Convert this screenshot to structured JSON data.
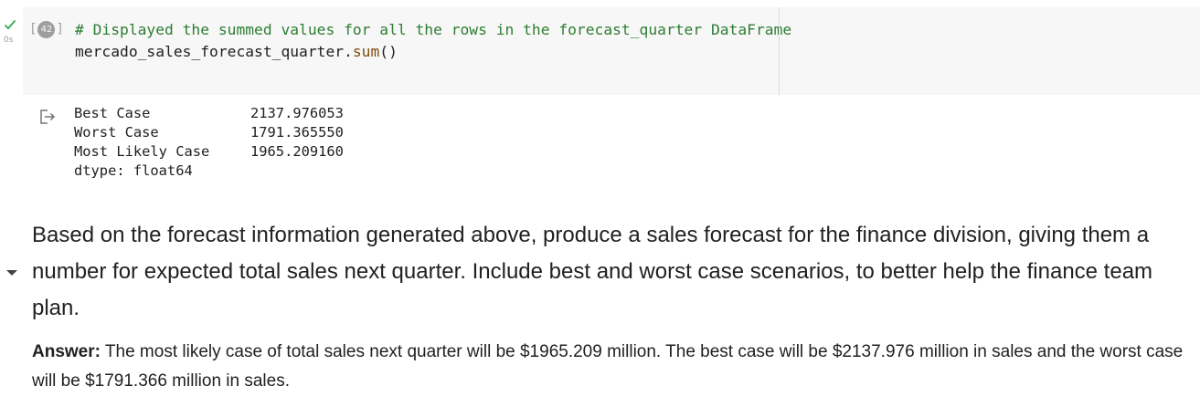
{
  "code_cell": {
    "execution_count": "42",
    "exec_time": "0s",
    "comment_line": "# Displayed the summed values for all the rows in the forecast_quarter DataFrame",
    "code_object": "mercado_sales_forecast_quarter.",
    "code_func": "sum",
    "code_parens": "()"
  },
  "output": {
    "rows": [
      {
        "label": "Best Case",
        "value": "2137.976053"
      },
      {
        "label": "Worst Case",
        "value": "1791.365550"
      },
      {
        "label": "Most Likely Case",
        "value": "1965.209160"
      }
    ],
    "dtype": "dtype: float64"
  },
  "markdown": {
    "question": "Based on the forecast information generated above, produce a sales forecast for the finance division, giving them a number for expected total sales next quarter. Include best and worst case scenarios, to better help the finance team plan.",
    "answer_label": "Answer:",
    "answer_text": " The most likely case of total sales next quarter will be $1965.209 million. The best case will be $2137.976 million in sales and the worst case will be $1791.366 million in sales."
  },
  "colors": {
    "check": "#34a853",
    "comment": "#2e7d32",
    "function": "#7b4b0f",
    "editor_bg": "#f7f7f7"
  },
  "icons": {
    "run_status": "check-icon",
    "output": "output-redirect-icon",
    "collapse": "caret-down-icon"
  }
}
